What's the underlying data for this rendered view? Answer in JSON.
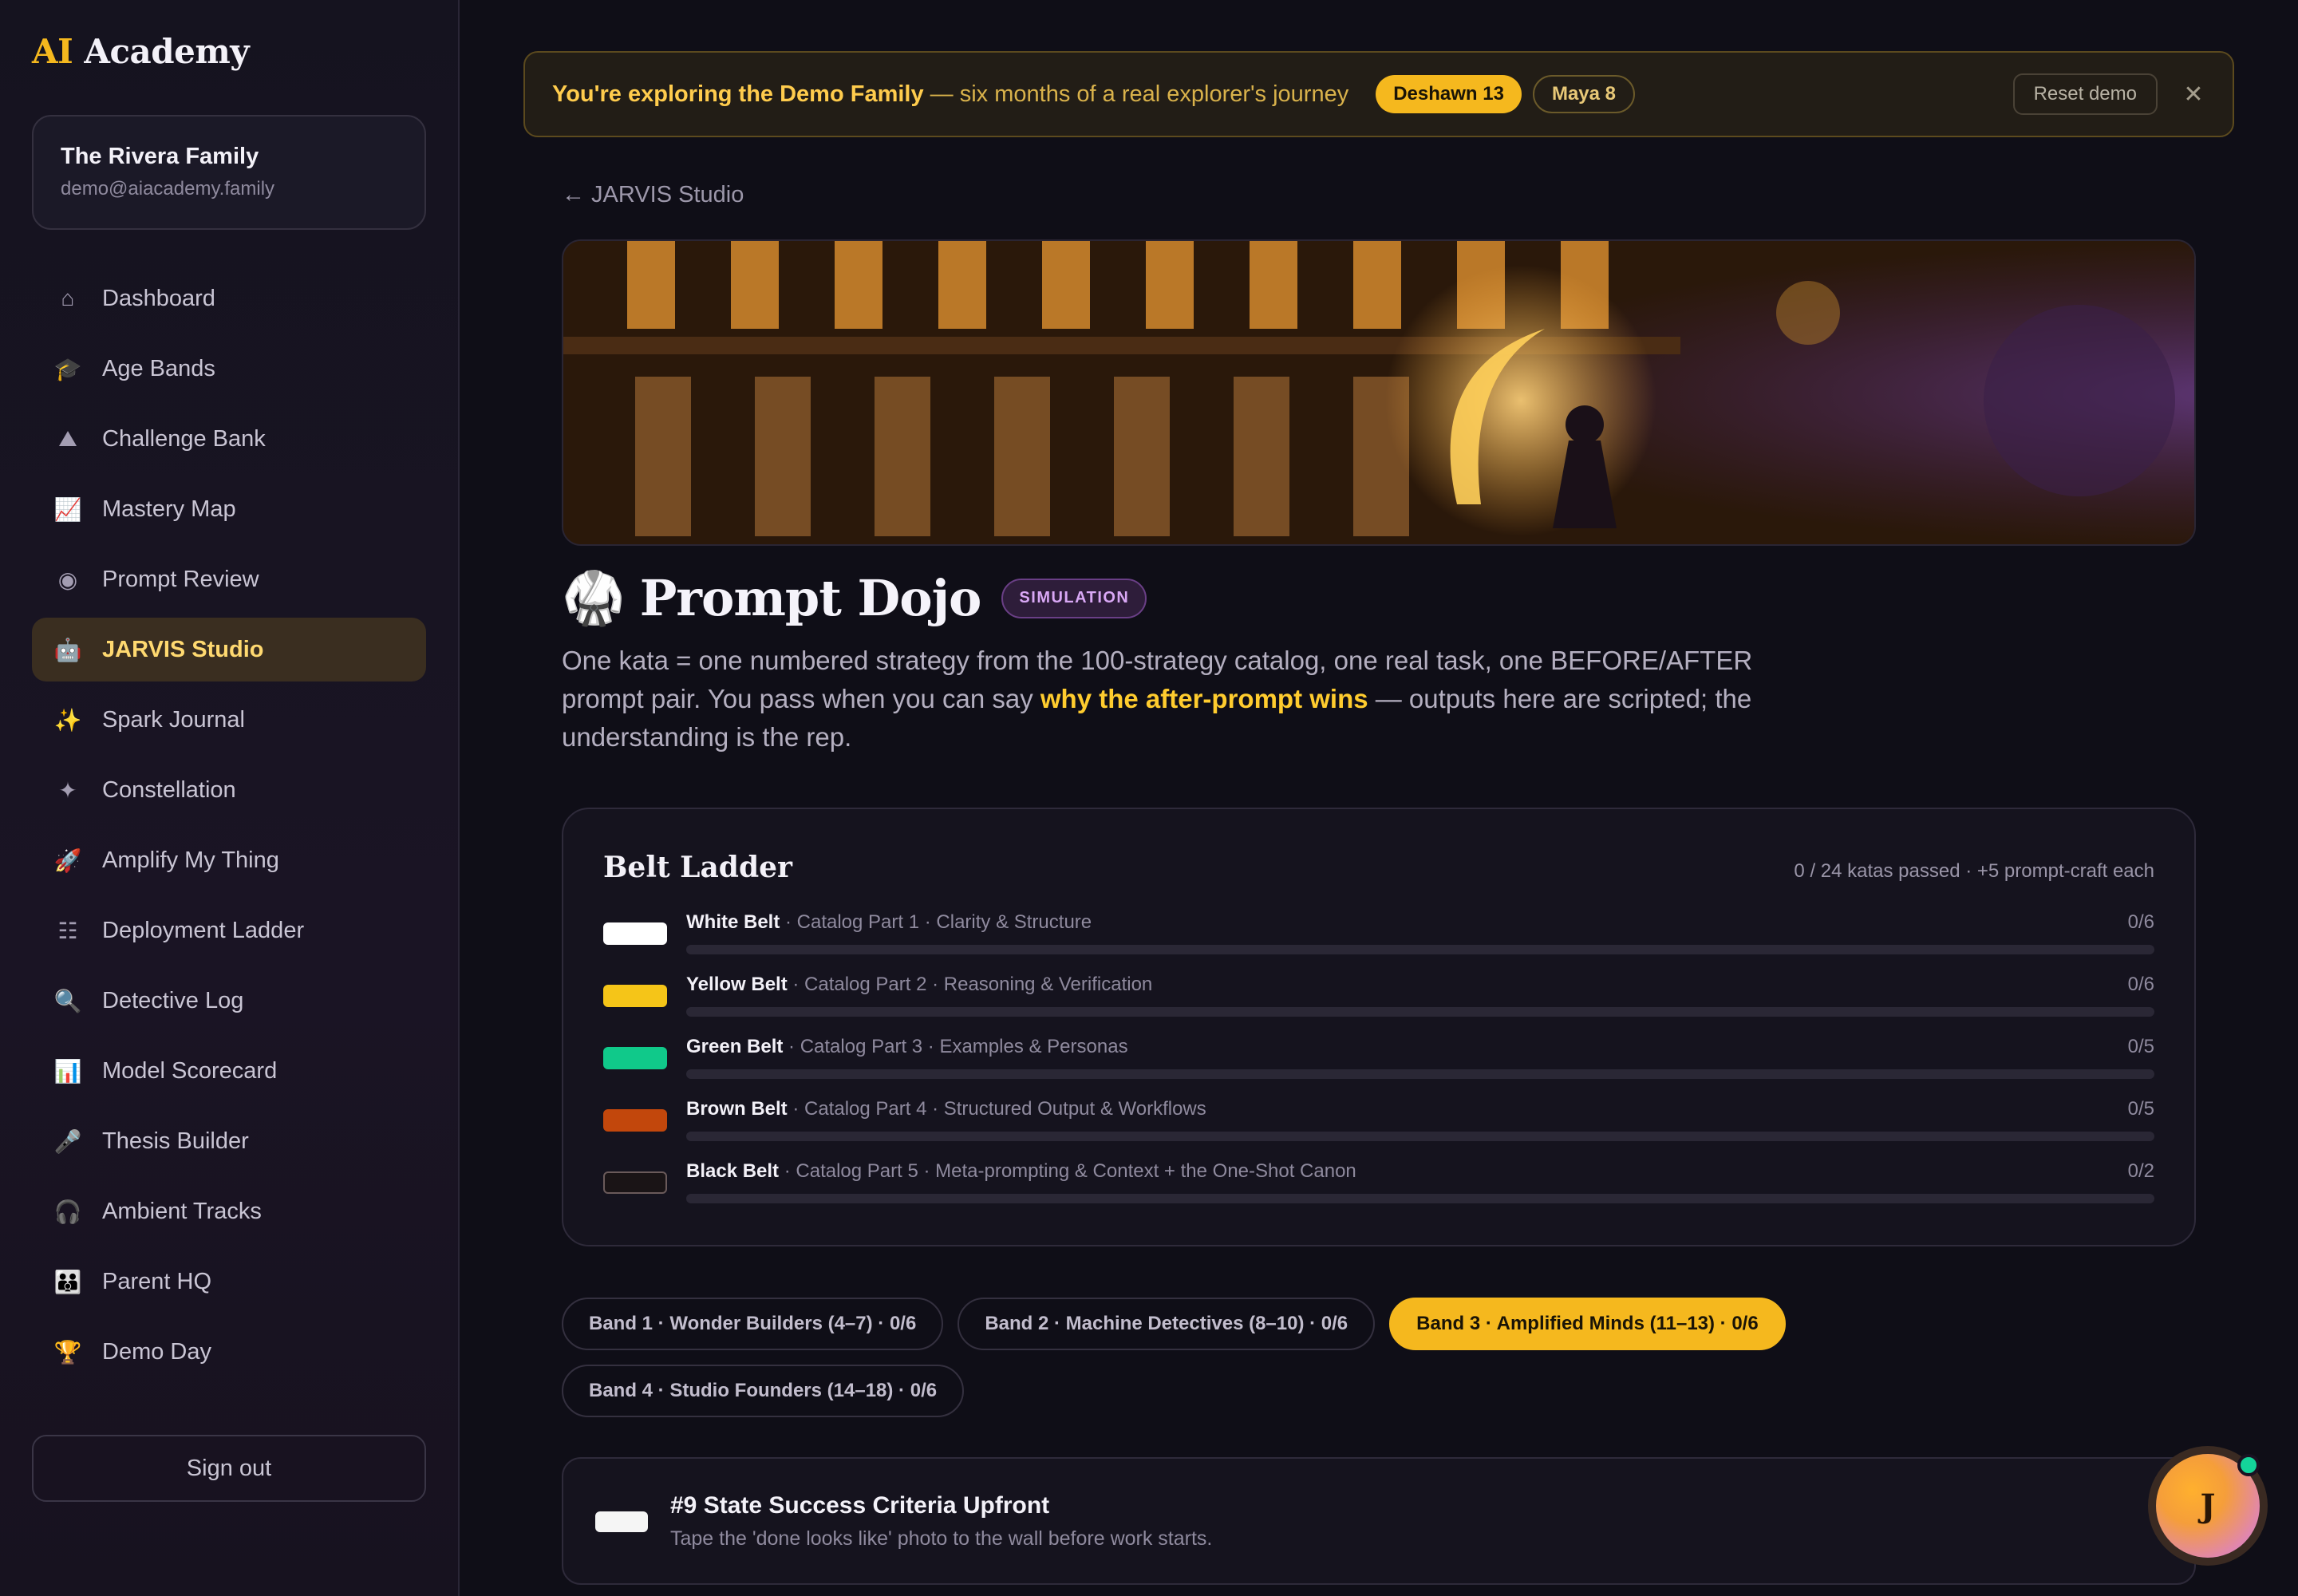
{
  "app": {
    "logo_ai": "AI",
    "logo_rest": " Academy"
  },
  "family": {
    "name": "The Rivera Family",
    "email": "demo@aiacademy.family"
  },
  "sidebar": {
    "items": [
      {
        "label": "Dashboard",
        "icon": "house-icon",
        "glyph": "⌂"
      },
      {
        "label": "Age Bands",
        "icon": "graduation-cap-icon",
        "glyph": "🎓"
      },
      {
        "label": "Challenge Bank",
        "icon": "climber-icon",
        "glyph": "⛰"
      },
      {
        "label": "Mastery Map",
        "icon": "chart-up-icon",
        "glyph": "📈"
      },
      {
        "label": "Prompt Review",
        "icon": "review-icon",
        "glyph": "◉"
      },
      {
        "label": "JARVIS Studio",
        "icon": "robot-icon",
        "glyph": "🤖"
      },
      {
        "label": "Spark Journal",
        "icon": "sparkles-icon",
        "glyph": "✨"
      },
      {
        "label": "Constellation",
        "icon": "galaxy-icon",
        "glyph": "✦"
      },
      {
        "label": "Amplify My Thing",
        "icon": "rocket-icon",
        "glyph": "🚀"
      },
      {
        "label": "Deployment Ladder",
        "icon": "ladder-icon",
        "glyph": "☷"
      },
      {
        "label": "Detective Log",
        "icon": "magnifier-icon",
        "glyph": "🔍"
      },
      {
        "label": "Model Scorecard",
        "icon": "bar-chart-icon",
        "glyph": "📊"
      },
      {
        "label": "Thesis Builder",
        "icon": "microphone-icon",
        "glyph": "🎤"
      },
      {
        "label": "Ambient Tracks",
        "icon": "headphones-icon",
        "glyph": "🎧"
      },
      {
        "label": "Parent HQ",
        "icon": "family-icon",
        "glyph": "👪"
      },
      {
        "label": "Demo Day",
        "icon": "trophy-icon",
        "glyph": "🏆"
      }
    ],
    "active_index": 5,
    "signout_label": "Sign out"
  },
  "banner": {
    "strong": "You're exploring the Demo Family",
    "rest": " — six months of a real explorer's journey",
    "chip_active": "Deshawn 13",
    "chip_other": "Maya 8",
    "reset_label": "Reset demo",
    "close_glyph": "✕"
  },
  "back_link": "← JARVIS Studio",
  "page": {
    "title_icon": "🥋",
    "title": "Prompt Dojo",
    "badge": "SIMULATION",
    "intro_a": "One kata = one numbered strategy from the 100-strategy catalog, one real task, one BEFORE/AFTER prompt pair. You pass when you can say ",
    "intro_hl": "why the after-prompt wins",
    "intro_b": " — outputs here are scripted; the understanding is the rep."
  },
  "belt_ladder": {
    "title": "Belt Ladder",
    "summary": "0 / 24 katas passed · +5 prompt-craft each",
    "belts": [
      {
        "name": "White Belt",
        "desc": " · Catalog Part 1 · Clarity & Structure",
        "count": "0/6",
        "color": "#ffffff",
        "progress": 0
      },
      {
        "name": "Yellow Belt",
        "desc": " · Catalog Part 2 · Reasoning & Verification",
        "count": "0/6",
        "color": "#f5c518",
        "progress": 0
      },
      {
        "name": "Green Belt",
        "desc": " · Catalog Part 3 · Examples & Personas",
        "count": "0/5",
        "color": "#10c98a",
        "progress": 0
      },
      {
        "name": "Brown Belt",
        "desc": " · Catalog Part 4 · Structured Output & Workflows",
        "count": "0/5",
        "color": "#c2470c",
        "progress": 0
      },
      {
        "name": "Black Belt",
        "desc": " · Catalog Part 5 · Meta-prompting & Context + the One-Shot Canon",
        "count": "0/2",
        "color": "#1a1416",
        "progress": 0
      }
    ]
  },
  "bands": [
    {
      "label": "Band 1 · Wonder Builders (4–7) · 0/6",
      "active": false
    },
    {
      "label": "Band 2 · Machine Detectives (8–10) · 0/6",
      "active": false
    },
    {
      "label": "Band 3 · Amplified Minds (11–13) · 0/6",
      "active": true
    },
    {
      "label": "Band 4 · Studio Founders (14–18) · 0/6",
      "active": false
    }
  ],
  "kata": {
    "title": "#9 State Success Criteria Upfront",
    "subtitle": "Tape the 'done looks like' photo to the wall before work starts.",
    "chevron": "▾"
  },
  "jarvis": {
    "initial": "J"
  },
  "colors": {
    "accent": "#f5b81e",
    "bg": "#0f0e17",
    "online": "#14d49a"
  }
}
